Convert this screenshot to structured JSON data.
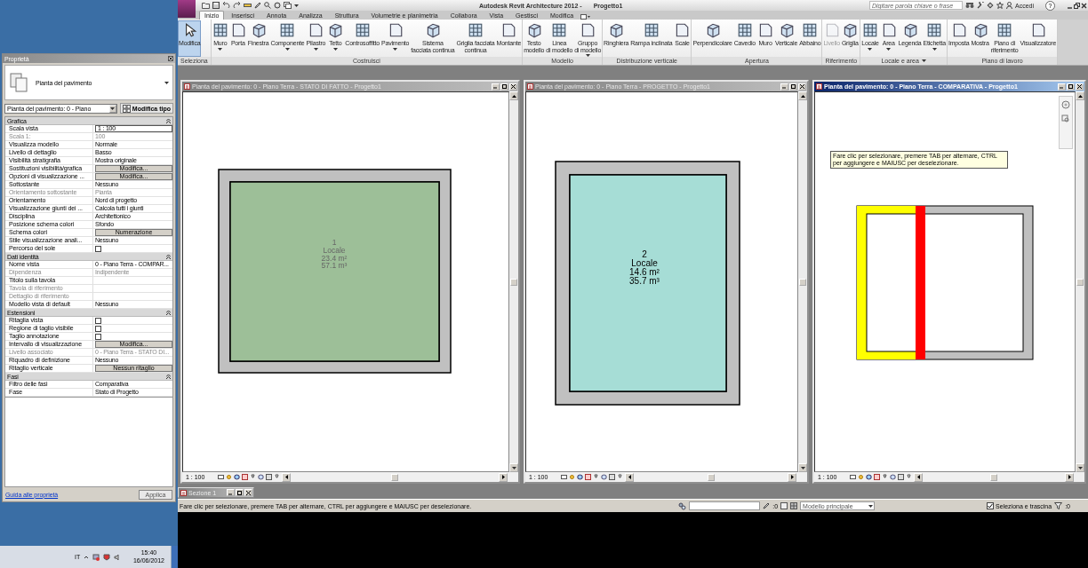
{
  "app": {
    "title": "Autodesk Revit Architecture 2012 -",
    "project": "Progetto1",
    "search": {
      "placeholder": "Digitare parola chiave o frase"
    },
    "sign_in": "Accedi",
    "help": "?"
  },
  "tabs": [
    {
      "label": "Inizio",
      "selected": true
    },
    {
      "label": "Inserisci",
      "selected": false
    },
    {
      "label": "Annota",
      "selected": false
    },
    {
      "label": "Analizza",
      "selected": false
    },
    {
      "label": "Struttura",
      "selected": false
    },
    {
      "label": "Volumetrie e planimetria",
      "selected": false
    },
    {
      "label": "Collabora",
      "selected": false
    },
    {
      "label": "Vista",
      "selected": false
    },
    {
      "label": "Gestisci",
      "selected": false
    },
    {
      "label": "Modifica",
      "selected": false
    }
  ],
  "ribbon_panels": [
    {
      "label": "Seleziona",
      "expandable": false,
      "tools": [
        {
          "label": "Modifica",
          "selected": true,
          "dropdown": false,
          "disabled": false
        }
      ]
    },
    {
      "label": "Costruisci",
      "expandable": false,
      "tools": [
        {
          "label": "Muro",
          "selected": false,
          "dropdown": true,
          "disabled": false
        },
        {
          "label": "Porta",
          "selected": false,
          "dropdown": false,
          "disabled": false
        },
        {
          "label": "Finestra",
          "selected": false,
          "dropdown": false,
          "disabled": false
        },
        {
          "label": "Componente",
          "selected": false,
          "dropdown": true,
          "disabled": false
        },
        {
          "label": "Pilastro",
          "selected": false,
          "dropdown": true,
          "disabled": false
        },
        {
          "label": "Tetto",
          "selected": false,
          "dropdown": true,
          "disabled": false
        },
        {
          "label": "Controsoffitto",
          "selected": false,
          "dropdown": false,
          "disabled": false
        },
        {
          "label": "Pavimento",
          "selected": false,
          "dropdown": true,
          "disabled": false
        },
        {
          "label": "Sistema\nfacciata continua",
          "selected": false,
          "dropdown": false,
          "disabled": false
        },
        {
          "label": "Griglia facciata\ncontinua",
          "selected": false,
          "dropdown": false,
          "disabled": false
        },
        {
          "label": "Montante",
          "selected": false,
          "dropdown": false,
          "disabled": false
        }
      ]
    },
    {
      "label": "Modello",
      "expandable": false,
      "tools": [
        {
          "label": "Testo\nmodello",
          "selected": false,
          "dropdown": false,
          "disabled": false
        },
        {
          "label": "Linea\ndi modello",
          "selected": false,
          "dropdown": false,
          "disabled": false
        },
        {
          "label": "Gruppo\ndi modello",
          "selected": false,
          "dropdown": true,
          "disabled": false
        }
      ]
    },
    {
      "label": "Distribuzione verticale",
      "expandable": false,
      "tools": [
        {
          "label": "Ringhiera",
          "selected": false,
          "dropdown": false,
          "disabled": false
        },
        {
          "label": "Rampa inclinata",
          "selected": false,
          "dropdown": false,
          "disabled": false
        },
        {
          "label": "Scale",
          "selected": false,
          "dropdown": false,
          "disabled": false
        }
      ]
    },
    {
      "label": "Apertura",
      "expandable": false,
      "tools": [
        {
          "label": "Perpendicolare",
          "selected": false,
          "dropdown": false,
          "disabled": false
        },
        {
          "label": "Cavedio",
          "selected": false,
          "dropdown": false,
          "disabled": false
        },
        {
          "label": "Muro",
          "selected": false,
          "dropdown": false,
          "disabled": false
        },
        {
          "label": "Verticale",
          "selected": false,
          "dropdown": false,
          "disabled": false
        },
        {
          "label": "Abbaino",
          "selected": false,
          "dropdown": false,
          "disabled": false
        }
      ]
    },
    {
      "label": "Riferimento",
      "expandable": false,
      "tools": [
        {
          "label": "Livello",
          "selected": false,
          "dropdown": false,
          "disabled": true
        },
        {
          "label": "Griglia",
          "selected": false,
          "dropdown": false,
          "disabled": false
        }
      ]
    },
    {
      "label": "Locale e area",
      "expandable": true,
      "tools": [
        {
          "label": "Locale",
          "selected": false,
          "dropdown": true,
          "disabled": false
        },
        {
          "label": "Area",
          "selected": false,
          "dropdown": true,
          "disabled": false
        },
        {
          "label": "Legenda",
          "selected": false,
          "dropdown": false,
          "disabled": false
        },
        {
          "label": "Etichetta",
          "selected": false,
          "dropdown": true,
          "disabled": false
        }
      ]
    },
    {
      "label": "Piano di lavoro",
      "expandable": false,
      "tools": [
        {
          "label": "Imposta",
          "selected": false,
          "dropdown": false,
          "disabled": false
        },
        {
          "label": "Mostra",
          "selected": false,
          "dropdown": false,
          "disabled": false
        },
        {
          "label": "Piano di\nriferimento",
          "selected": false,
          "dropdown": false,
          "disabled": false
        },
        {
          "label": "Visualizzatore",
          "selected": false,
          "dropdown": false,
          "disabled": false
        }
      ]
    }
  ],
  "properties": {
    "title": "Proprietà",
    "type_name": "Pianta del pavimento",
    "selector": "Pianta del pavimento: 0 - Piano",
    "edit_type": "Modifica tipo",
    "groups": [
      {
        "name": "Grafica",
        "expanded": true,
        "rows": [
          {
            "label": "Scala vista",
            "value": "1 : 100",
            "kind": "input",
            "disabled": false
          },
          {
            "label": "Scala  1:",
            "value": "100",
            "kind": "text",
            "disabled": true
          },
          {
            "label": "Visualizza modello",
            "value": "Normale",
            "kind": "text",
            "disabled": false
          },
          {
            "label": "Livello di dettaglio",
            "value": "Basso",
            "kind": "text",
            "disabled": false
          },
          {
            "label": "Visibilità stratigrafia",
            "value": "Mostra originale",
            "kind": "text",
            "disabled": false
          },
          {
            "label": "Sostituzioni visibilità/grafica",
            "value": "Modifica...",
            "kind": "button",
            "disabled": false
          },
          {
            "label": "Opzioni di visualizzazione ...",
            "value": "Modifica...",
            "kind": "button",
            "disabled": false
          },
          {
            "label": "Sottostante",
            "value": "Nessuno",
            "kind": "text",
            "disabled": false
          },
          {
            "label": "Orientamento sottostante",
            "value": "Pianta",
            "kind": "text",
            "disabled": true
          },
          {
            "label": "Orientamento",
            "value": "Nord di progetto",
            "kind": "text",
            "disabled": false
          },
          {
            "label": "Visualizzazione giunti dei ...",
            "value": "Calcola tutti i giunti",
            "kind": "text",
            "disabled": false
          },
          {
            "label": "Disciplina",
            "value": "Architettonico",
            "kind": "text",
            "disabled": false
          },
          {
            "label": "Posizione schema colori",
            "value": "Sfondo",
            "kind": "text",
            "disabled": false
          },
          {
            "label": "Schema colori",
            "value": "Numerazione",
            "kind": "button",
            "disabled": false
          },
          {
            "label": "Stile visualizzazione anali...",
            "value": "Nessuno",
            "kind": "text",
            "disabled": false
          },
          {
            "label": "Percorso del sole",
            "kind": "checkbox",
            "checked": false,
            "disabled": false
          }
        ]
      },
      {
        "name": "Dati identità",
        "expanded": true,
        "rows": [
          {
            "label": "Nome vista",
            "value": "0 - Piano Terra - COMPAR...",
            "kind": "text",
            "disabled": false
          },
          {
            "label": "Dipendenza",
            "value": "Indipendente",
            "kind": "text",
            "disabled": true
          },
          {
            "label": "Titolo sulla tavola",
            "kind": "text",
            "disabled": false
          },
          {
            "label": "Tavola di riferimento",
            "kind": "text",
            "disabled": true
          },
          {
            "label": "Dettaglio di riferimento",
            "kind": "text",
            "disabled": true
          },
          {
            "label": "Modello vista di default",
            "value": "Nessuno",
            "kind": "text",
            "disabled": false
          }
        ]
      },
      {
        "name": "Estensioni",
        "expanded": true,
        "rows": [
          {
            "label": "Ritaglia vista",
            "kind": "checkbox",
            "checked": false,
            "disabled": false
          },
          {
            "label": "Regione di taglio visibile",
            "kind": "checkbox",
            "checked": false,
            "disabled": false
          },
          {
            "label": "Taglio annotazione",
            "kind": "checkbox",
            "checked": false,
            "disabled": false
          },
          {
            "label": "Intervallo di visualizzazione",
            "value": "Modifica...",
            "kind": "button",
            "disabled": false
          },
          {
            "label": "Livello associato",
            "value": "0 - Piano Terra - STATO DI...",
            "kind": "text",
            "disabled": true
          },
          {
            "label": "Riquadro di definizione",
            "value": "Nessuno",
            "kind": "text",
            "disabled": false
          },
          {
            "label": "Ritaglio verticale",
            "value": "Nessun ritaglio",
            "kind": "button",
            "disabled": false
          }
        ]
      },
      {
        "name": "Fasi",
        "expanded": true,
        "rows": [
          {
            "label": "Filtro delle fasi",
            "value": "Comparativa",
            "kind": "text",
            "disabled": false
          },
          {
            "label": "Fase",
            "value": "Stato di Progetto",
            "kind": "text",
            "disabled": false
          }
        ]
      }
    ],
    "help_link": "Guida alle proprietà",
    "apply": {
      "label": "Applica",
      "disabled": true
    }
  },
  "views": [
    {
      "title": "Pianta del pavimento: 0 - Piano Terra - STATO DI FATTO - Progetto1",
      "active": false,
      "scale": "1 : 100",
      "kind": "room",
      "room": {
        "number": "1",
        "name": "Locale",
        "area": "23.4 m²",
        "volume": "57.1 m³",
        "color": "#9dbf98",
        "dimmed": true
      }
    },
    {
      "title": "Pianta del pavimento: 0 - Piano Terra - PROGETTO - Progetto1",
      "active": false,
      "scale": "1 : 100",
      "kind": "room",
      "room": {
        "number": "2",
        "name": "Locale",
        "area": "14.6 m²",
        "volume": "35.7 m³",
        "color": "#a6ddd6",
        "dimmed": false
      }
    },
    {
      "title": "Pianta del pavimento: 0 - Piano Terra - COMPARATIVA - Progetto1",
      "active": true,
      "scale": "1 : 100",
      "kind": "comparison",
      "tooltip": "Fare clic per selezionare, premere TAB per alternare, CTRL per aggiungere e MAIUSC per deselezionare."
    }
  ],
  "minimized_window": {
    "title": "Sezione 1"
  },
  "status_bar": {
    "message": "Fare clic per selezionare, premere TAB per alternare, CTRL per aggiungere e MAIUSC per deselezionare.",
    "editing_requests": ":0",
    "workset": "Modello principale",
    "select_drag": {
      "label": "Seleziona e trascina",
      "checked": true
    },
    "filter_count": ":0"
  },
  "taskbar": {
    "language": "IT",
    "time": "15:40",
    "date": "16/06/2012"
  }
}
